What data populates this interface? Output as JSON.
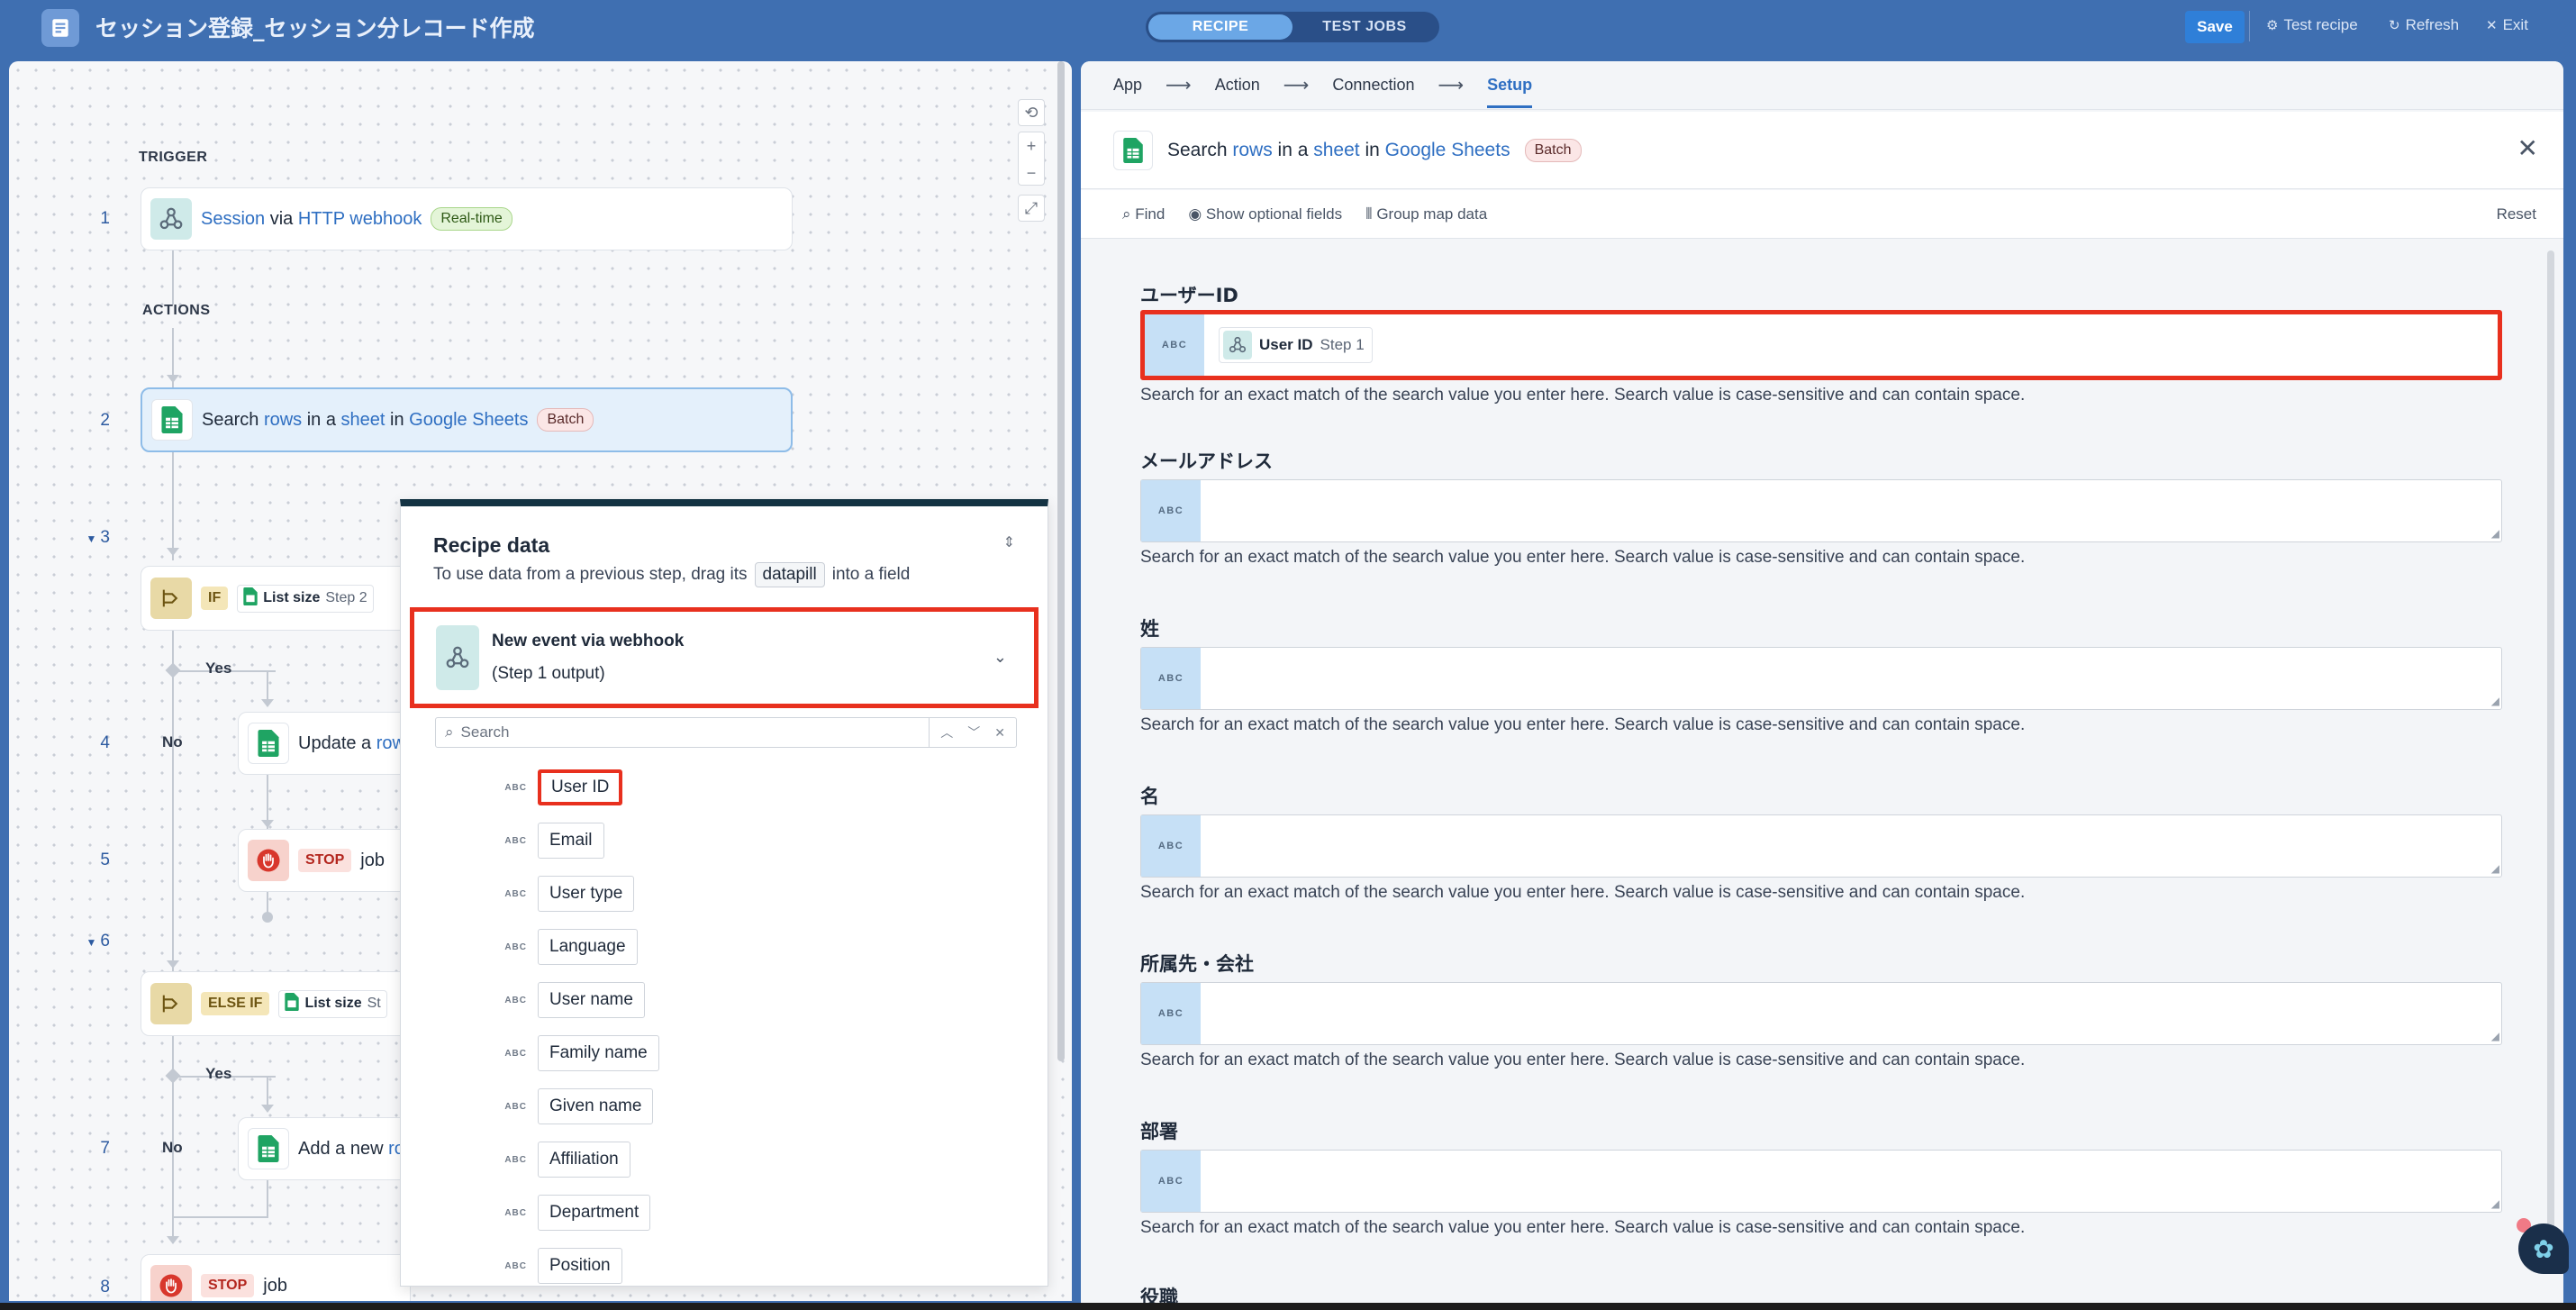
{
  "header": {
    "title": "セッション登録_セッション分レコード作成",
    "tabs": [
      {
        "label": "RECIPE",
        "active": true
      },
      {
        "label": "TEST JOBS",
        "active": false
      }
    ],
    "save_label": "Save",
    "actions": [
      {
        "label": "Test recipe",
        "icon": "gear-icon"
      },
      {
        "label": "Refresh",
        "icon": "refresh-icon"
      },
      {
        "label": "Exit",
        "icon": "close-icon"
      }
    ]
  },
  "canvas": {
    "trigger_label": "TRIGGER",
    "actions_label": "ACTIONS",
    "steps": [
      {
        "num": "1",
        "parts": [
          "Session",
          " via ",
          "HTTP webhook"
        ],
        "badge": "Real-time"
      },
      {
        "num": "2",
        "parts": [
          "Search ",
          "rows",
          " in a ",
          "sheet",
          " in ",
          "Google Sheets"
        ],
        "badge": "Batch"
      },
      {
        "num": "3",
        "keyword": "IF",
        "pill_label": "List size",
        "pill_step": "Step 2"
      },
      {
        "num": "4",
        "parts": [
          "Update a ",
          "row"
        ]
      },
      {
        "num": "5",
        "keyword": "STOP",
        "text": "job"
      },
      {
        "num": "6",
        "keyword": "ELSE IF",
        "pill_label": "List size",
        "pill_step": "St"
      },
      {
        "num": "7",
        "parts": [
          "Add a new ",
          "ro"
        ]
      },
      {
        "num": "8",
        "keyword": "STOP",
        "text": "job"
      }
    ],
    "branch": {
      "yes": "Yes",
      "no": "No"
    }
  },
  "recipe_data": {
    "title": "Recipe data",
    "subtitle_pre": "To use data from a previous step, drag its",
    "subtitle_pill": "datapill",
    "subtitle_post": "into a field",
    "source_title": "New event via webhook",
    "source_sub": "(Step 1 output)",
    "search_placeholder": "Search",
    "fields": [
      "User ID",
      "Email",
      "User type",
      "Language",
      "User name",
      "Family name",
      "Given name",
      "Affiliation",
      "Department",
      "Position"
    ],
    "abc": "ABC"
  },
  "config": {
    "breadcrumbs": [
      "App",
      "Action",
      "Connection",
      "Setup"
    ],
    "action_parts": [
      "Search ",
      "rows",
      " in a ",
      "sheet",
      " in ",
      "Google Sheets"
    ],
    "action_badge": "Batch",
    "tools": [
      "Find",
      "Show optional fields",
      "Group map data"
    ],
    "reset": "Reset",
    "abc": "ABC",
    "hint": "Search for an exact match of the search value you enter here. Search value is case-sensitive and can contain space.",
    "fields": [
      {
        "label": "ユーザーID",
        "pill_label": "User ID",
        "pill_step": "Step 1"
      },
      {
        "label": "メールアドレス"
      },
      {
        "label": "姓"
      },
      {
        "label": "名"
      },
      {
        "label": "所属先・会社"
      },
      {
        "label": "部署"
      },
      {
        "label": "役職"
      }
    ]
  }
}
